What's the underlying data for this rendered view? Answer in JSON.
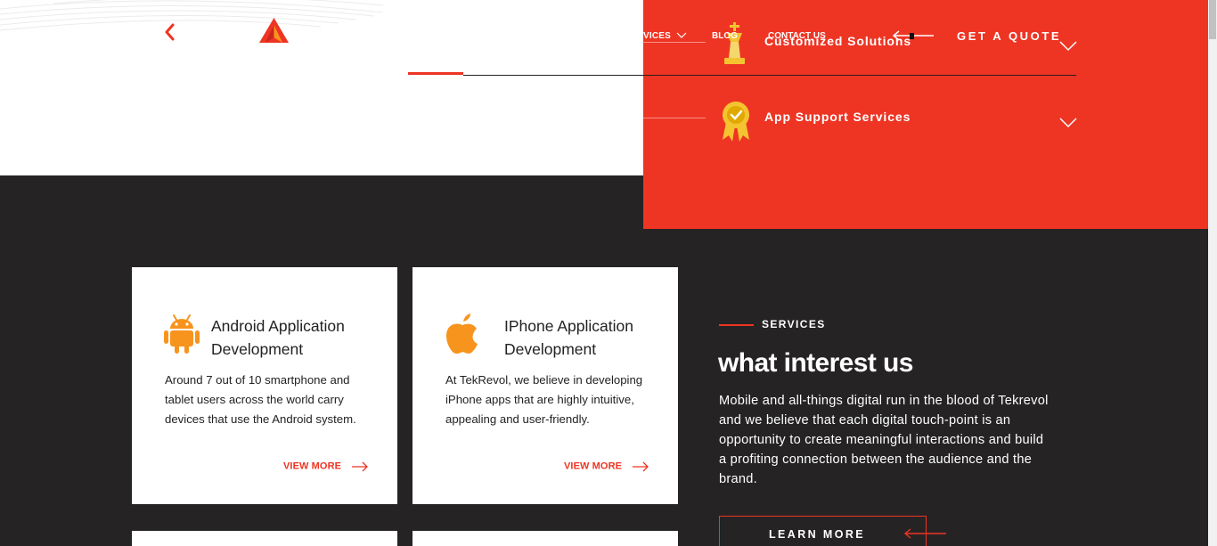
{
  "header": {
    "nav": {
      "services_label": "VICES",
      "blog_label": "BLOG",
      "contact_label": "CONTACT US",
      "quote_label": "GET A QUOTE"
    },
    "icons": {
      "back": "chevron-left-icon",
      "logo": "triangle-logo-icon"
    }
  },
  "mega_menu": {
    "items": [
      {
        "label": "Customized Solutions",
        "icon": "chess-king-icon"
      },
      {
        "label": "App Support Services",
        "icon": "award-badge-icon"
      }
    ]
  },
  "cards": [
    {
      "title": "Android Application Development",
      "description": "Around 7 out of 10 smartphone and tablet users across the world carry devices that use the Android system.",
      "link_label": "VIEW MORE",
      "icon": "android-icon"
    },
    {
      "title": "IPhone Application Development",
      "description": "At TekRevol, we believe in developing iPhone apps that are highly intuitive, appealing and user-friendly.",
      "link_label": "VIEW MORE",
      "icon": "apple-icon"
    }
  ],
  "services_section": {
    "eyebrow": "SERVICES",
    "heading": "what interest us",
    "body": "Mobile and all-things digital run in the blood of Tekrevol and we believe that each digital touch-point is an opportunity to create meaningful interactions and build a profiting connection between the audience and the brand.",
    "cta_label": "LEARN MORE"
  },
  "colors": {
    "accent": "#ee3524",
    "dark_background": "#252324",
    "card_background": "#ffffff",
    "icon_orange": "#f7941d",
    "icon_gold": "#f4c430"
  }
}
